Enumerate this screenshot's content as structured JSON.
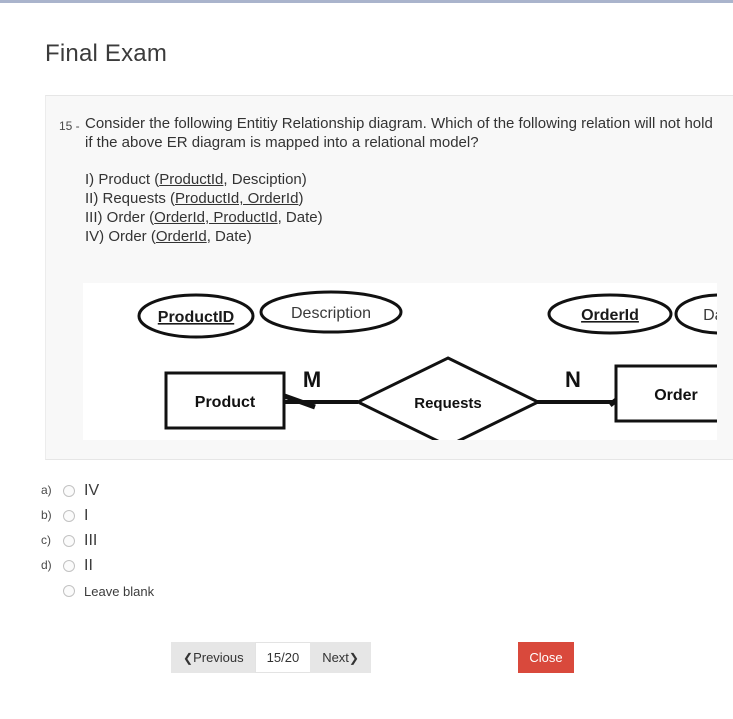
{
  "page": {
    "top_accent_color": "#aab4cc",
    "title": "Final Exam"
  },
  "question": {
    "number": "15 -",
    "stem": "Consider the following Entitiy Relationship diagram. Which of the following relation will not hold if the above ER diagram is mapped into a relational model?",
    "relations": [
      {
        "label": "I) Product (",
        "underlined": "ProductId",
        "tail": ", Desciption)"
      },
      {
        "label": "II) Requests (",
        "underlined": "ProductId, OrderId",
        "tail": ")"
      },
      {
        "label": "III) Order (",
        "underlined": "OrderId, ProductId",
        "tail": ", Date)"
      },
      {
        "label": "IV) Order (",
        "underlined": "OrderId",
        "tail": ", Date)"
      }
    ]
  },
  "er_diagram": {
    "attributes": [
      {
        "name": "ProductID",
        "key": true
      },
      {
        "name": "Description",
        "key": false
      },
      {
        "name": "OrderId",
        "key": true
      },
      {
        "name": "Date",
        "key": false
      }
    ],
    "entities": [
      {
        "name": "Product"
      },
      {
        "name": "Order"
      }
    ],
    "relationship": {
      "name": "Requests"
    },
    "cardinality_left": "M",
    "cardinality_right": "N"
  },
  "options": [
    {
      "letter": "a)",
      "text": "IV",
      "selected": false
    },
    {
      "letter": "b)",
      "text": "I",
      "selected": false
    },
    {
      "letter": "c)",
      "text": "III",
      "selected": false
    },
    {
      "letter": "d)",
      "text": "II",
      "selected": false
    },
    {
      "letter": "",
      "text": "Leave blank",
      "selected": false
    }
  ],
  "footer": {
    "previous_label": "Previous",
    "counter_label": "15/20",
    "next_label": "Next",
    "close_label": "Close",
    "close_color": "#d9493c"
  }
}
